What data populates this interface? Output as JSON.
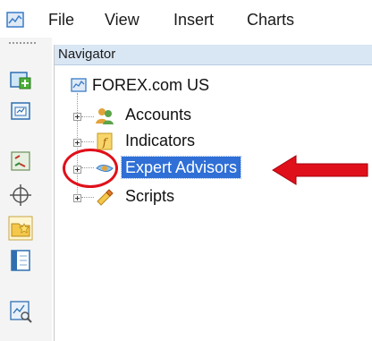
{
  "menubar": {
    "items": [
      {
        "label": "File"
      },
      {
        "label": "View"
      },
      {
        "label": "Insert"
      },
      {
        "label": "Charts"
      }
    ]
  },
  "navigator": {
    "title": "Navigator",
    "tree": {
      "root": {
        "label": "FOREX.com US"
      },
      "children": [
        {
          "label": "Accounts",
          "icon": "accounts-icon"
        },
        {
          "label": "Indicators",
          "icon": "indicators-icon"
        },
        {
          "label": "Expert Advisors",
          "icon": "expert-advisors-icon",
          "selected": true
        },
        {
          "label": "Scripts",
          "icon": "scripts-icon"
        }
      ]
    }
  },
  "annotations": {
    "circle_color": "#e0101a",
    "arrow_color": "#e0101a"
  },
  "colors": {
    "selection": "#2f6fd6",
    "header_bg": "#d9e6f4"
  }
}
